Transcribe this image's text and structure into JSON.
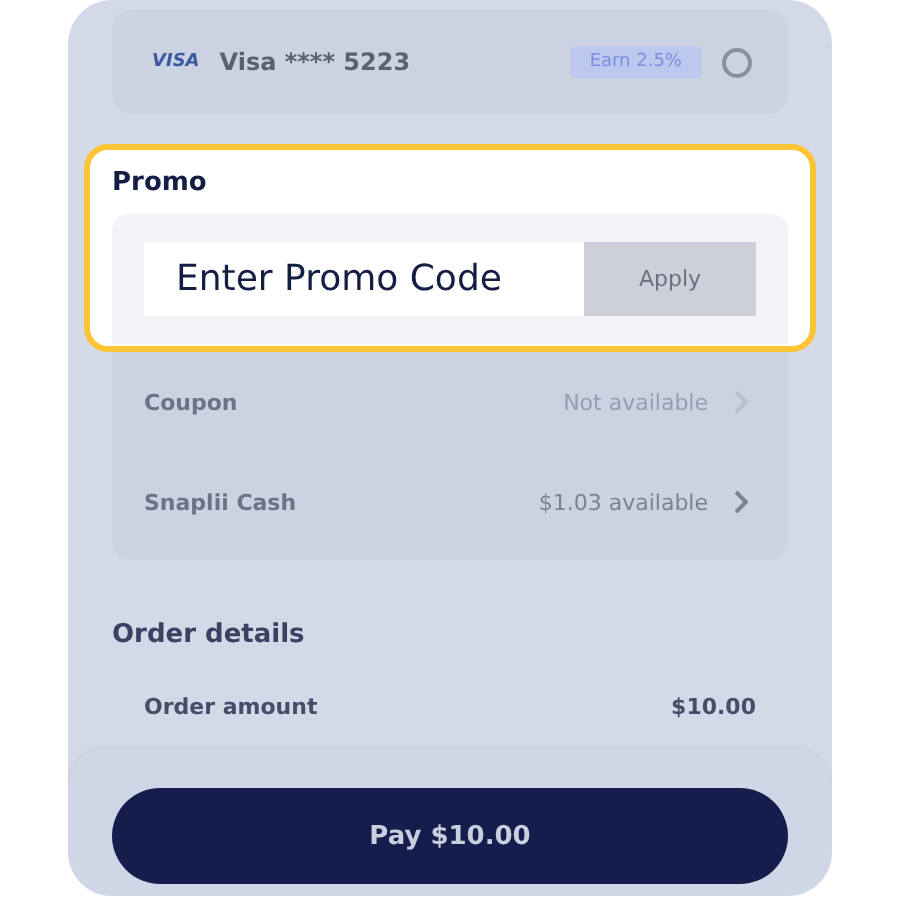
{
  "payment_card": {
    "brand": "VISA",
    "name": "Visa **** 5223",
    "badge": "Earn 2.5%",
    "selected": false
  },
  "promo": {
    "title": "Promo",
    "placeholder": "Enter Promo Code",
    "button": "Apply",
    "highlighted": true
  },
  "discounts": [
    {
      "label": "Coupon",
      "value": "Not available",
      "disabled": true
    },
    {
      "label": "Snaplii Cash",
      "value": "$1.03 available",
      "disabled": false
    }
  ],
  "order_details": {
    "title": "Order details",
    "rows": [
      {
        "label": "Order amount",
        "value": "$10.00"
      }
    ]
  },
  "pay_button": "Pay $10.00"
}
